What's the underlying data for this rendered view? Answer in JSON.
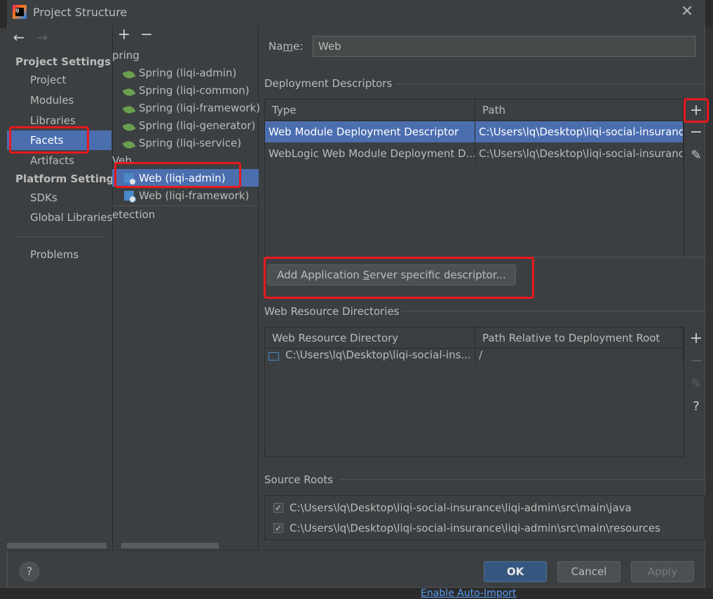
{
  "window": {
    "title": "Project Structure"
  },
  "sidebar": {
    "project_settings_header": "Project Settings",
    "project_settings_items": [
      "Project",
      "Modules",
      "Libraries",
      "Facets",
      "Artifacts"
    ],
    "platform_settings_header": "Platform Settings",
    "platform_settings_items": [
      "SDKs",
      "Global Libraries"
    ],
    "problems": "Problems",
    "selected": "Facets"
  },
  "tree": {
    "spring_group": "pring",
    "spring_items": [
      "Spring (liqi-admin)",
      "Spring (liqi-common)",
      "Spring (liqi-framework)",
      "Spring (liqi-generator)",
      "Spring (liqi-service)"
    ],
    "web_group": "Veb",
    "web_items": [
      "Web (liqi-admin)",
      "Web (liqi-framework)"
    ],
    "detection": "etection",
    "selected": "Web (liqi-admin)"
  },
  "detail": {
    "name_label_pre": "Na",
    "name_label_mn": "m",
    "name_label_post": "e:",
    "name_value": "Web",
    "deployment_descriptors": {
      "title": "Deployment Descriptors",
      "columns": [
        "Type",
        "Path"
      ],
      "rows": [
        {
          "type": "Web Module Deployment Descriptor",
          "path": "C:\\Users\\lq\\Desktop\\liqi-social-insurance"
        },
        {
          "type": "WebLogic Web Module Deployment D...",
          "path": "C:\\Users\\lq\\Desktop\\liqi-social-insurance"
        }
      ],
      "add_server_button_pre": "Add Application ",
      "add_server_button_mn": "S",
      "add_server_button_post": "erver specific descriptor..."
    },
    "web_resource_directories": {
      "title": "Web Resource Directories",
      "columns": [
        "Web Resource Directory",
        "Path Relative to Deployment Root"
      ],
      "rows": [
        {
          "directory": "C:\\Users\\lq\\Desktop\\liqi-social-ins...",
          "relative": "/"
        }
      ]
    },
    "source_roots": {
      "title": "Source Roots",
      "items": [
        {
          "path": "C:\\Users\\lq\\Desktop\\liqi-social-insurance\\liqi-admin\\src\\main\\java",
          "checked": true
        },
        {
          "path": "C:\\Users\\lq\\Desktop\\liqi-social-insurance\\liqi-admin\\src\\main\\resources",
          "checked": true
        }
      ]
    }
  },
  "footer": {
    "help": "?",
    "ok": "OK",
    "cancel": "Cancel",
    "apply": "Apply"
  },
  "background": {
    "bottom_link": "Enable Auto-Import"
  },
  "colors": {
    "selection": "#4b6eaf",
    "highlight": "#e8191c",
    "ok_button": "#365880"
  }
}
